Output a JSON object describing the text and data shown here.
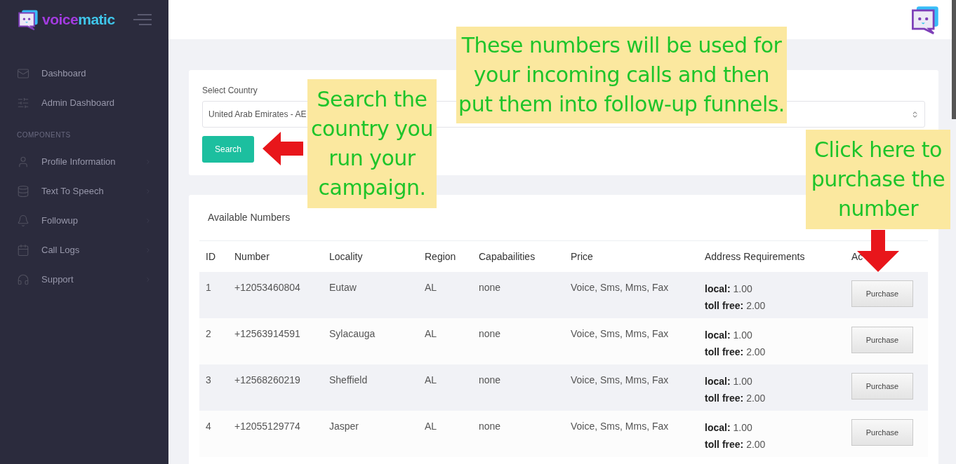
{
  "sidebar": {
    "brand": {
      "first": "voice",
      "second": "matic"
    },
    "nav_main": [
      {
        "label": "Dashboard"
      },
      {
        "label": "Admin Dashboard"
      }
    ],
    "section_title": "COMPONENTS",
    "nav_components": [
      {
        "label": "Profile Information"
      },
      {
        "label": "Text To Speech"
      },
      {
        "label": "Followup"
      },
      {
        "label": "Call Logs"
      },
      {
        "label": "Support"
      }
    ]
  },
  "search_card": {
    "label": "Select Country",
    "value": "United Arab Emirates - AE",
    "button": "Search"
  },
  "numbers_card": {
    "title": "Available Numbers",
    "columns": [
      "ID",
      "Number",
      "Locality",
      "Region",
      "Capabailities",
      "Price",
      "Address Requirements",
      "Ac"
    ],
    "rows": [
      {
        "id": "1",
        "number": "+12053460804",
        "locality": "Eutaw",
        "region": "AL",
        "capabilities": "none",
        "price": "Voice, Sms, Mms, Fax",
        "address": [
          {
            "label": "local:",
            "value": "1.00"
          },
          {
            "label": "toll free:",
            "value": "2.00"
          }
        ],
        "action": "Purchase"
      },
      {
        "id": "2",
        "number": "+12563914591",
        "locality": "Sylacauga",
        "region": "AL",
        "capabilities": "none",
        "price": "Voice, Sms, Mms, Fax",
        "address": [
          {
            "label": "local:",
            "value": "1.00"
          },
          {
            "label": "toll free:",
            "value": "2.00"
          }
        ],
        "action": "Purchase"
      },
      {
        "id": "3",
        "number": "+12568260219",
        "locality": "Sheffield",
        "region": "AL",
        "capabilities": "none",
        "price": "Voice, Sms, Mms, Fax",
        "address": [
          {
            "label": "local:",
            "value": "1.00"
          },
          {
            "label": "toll free:",
            "value": "2.00"
          }
        ],
        "action": "Purchase"
      },
      {
        "id": "4",
        "number": "+12055129774",
        "locality": "Jasper",
        "region": "AL",
        "capabilities": "none",
        "price": "Voice, Sms, Mms, Fax",
        "address": [
          {
            "label": "local:",
            "value": "1.00"
          },
          {
            "label": "toll free:",
            "value": "2.00"
          }
        ],
        "action": "Purchase"
      }
    ]
  },
  "annotations": [
    {
      "kind": "note",
      "lines": [
        "These numbers will be used for",
        "your incoming calls and then",
        "put them into follow-up funnels."
      ]
    },
    {
      "kind": "note",
      "lines": [
        "Search the",
        "country you",
        "run your",
        "campaign."
      ]
    },
    {
      "kind": "note",
      "lines": [
        "Click here to",
        "purchase the",
        "number"
      ]
    },
    {
      "kind": "arrow_left"
    },
    {
      "kind": "arrow_down"
    }
  ]
}
